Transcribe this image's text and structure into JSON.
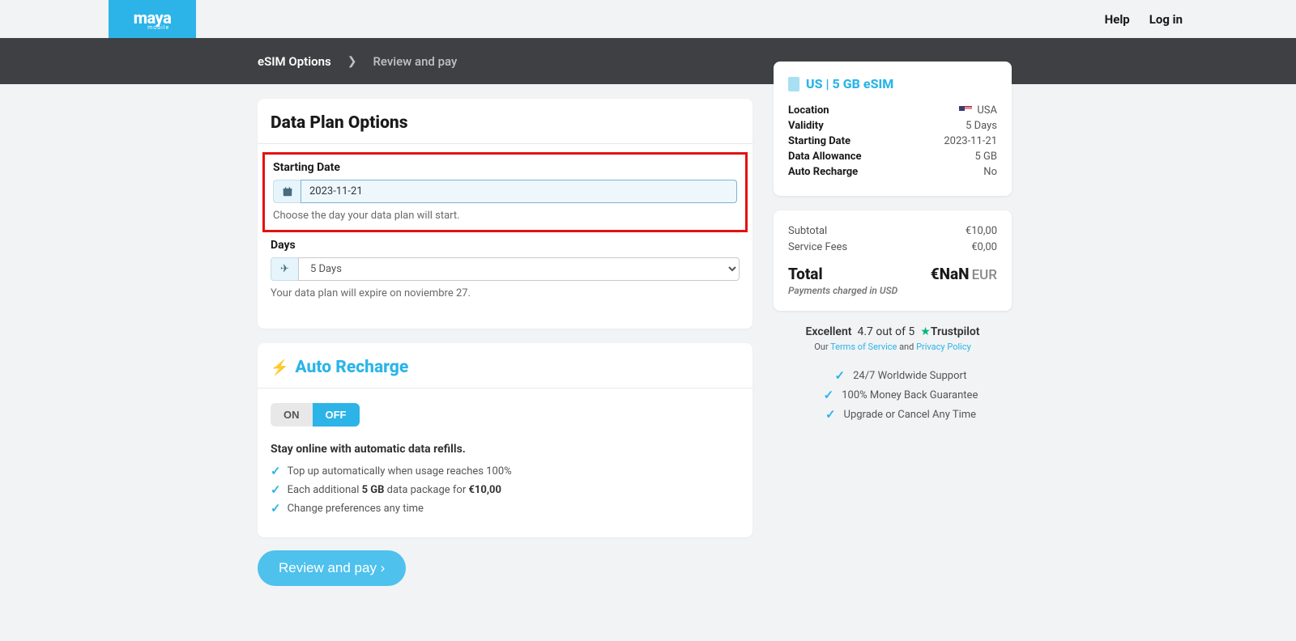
{
  "header": {
    "logo_main": "maya",
    "logo_sub": "mobile",
    "help": "Help",
    "login": "Log in"
  },
  "breadcrumb": {
    "step1": "eSIM Options",
    "step2": "Review and pay"
  },
  "data_plan": {
    "title": "Data Plan Options",
    "start_label": "Starting Date",
    "start_value": "2023-11-21",
    "start_helper": "Choose the day your data plan will start.",
    "days_label": "Days",
    "days_value": "5 Days",
    "days_helper": "Your data plan will expire on noviembre 27."
  },
  "auto_recharge": {
    "title": "Auto Recharge",
    "on": "ON",
    "off": "OFF",
    "refill_title": "Stay online with automatic data refills.",
    "f1": "Top up automatically when usage reaches 100%",
    "f2_pre": "Each additional ",
    "f2_gb": "5 GB",
    "f2_mid": " data package for ",
    "f2_price": "€10,00",
    "f3": "Change preferences any time"
  },
  "review_btn": "Review and pay ›",
  "summary": {
    "title": "US | 5 GB eSIM",
    "rows": {
      "location_l": "Location",
      "location_v": "USA",
      "validity_l": "Validity",
      "validity_v": "5 Days",
      "start_l": "Starting Date",
      "start_v": "2023-11-21",
      "data_l": "Data Allowance",
      "data_v": "5 GB",
      "auto_l": "Auto Recharge",
      "auto_v": "No"
    }
  },
  "pricing": {
    "subtotal_l": "Subtotal",
    "subtotal_v": "€10,00",
    "fees_l": "Service Fees",
    "fees_v": "€0,00",
    "total_l": "Total",
    "total_sub": "Payments charged in USD",
    "total_v": "€NaN",
    "total_cur": "EUR"
  },
  "trust": {
    "excellent": "Excellent",
    "score": "4.7 out of 5",
    "brand": "Trustpilot"
  },
  "legal": {
    "our": "Our ",
    "tos": "Terms of Service",
    "and": " and ",
    "pp": "Privacy Policy"
  },
  "benefits": {
    "b1": "24/7 Worldwide Support",
    "b2": "100% Money Back Guarantee",
    "b3": "Upgrade or Cancel Any Time"
  }
}
